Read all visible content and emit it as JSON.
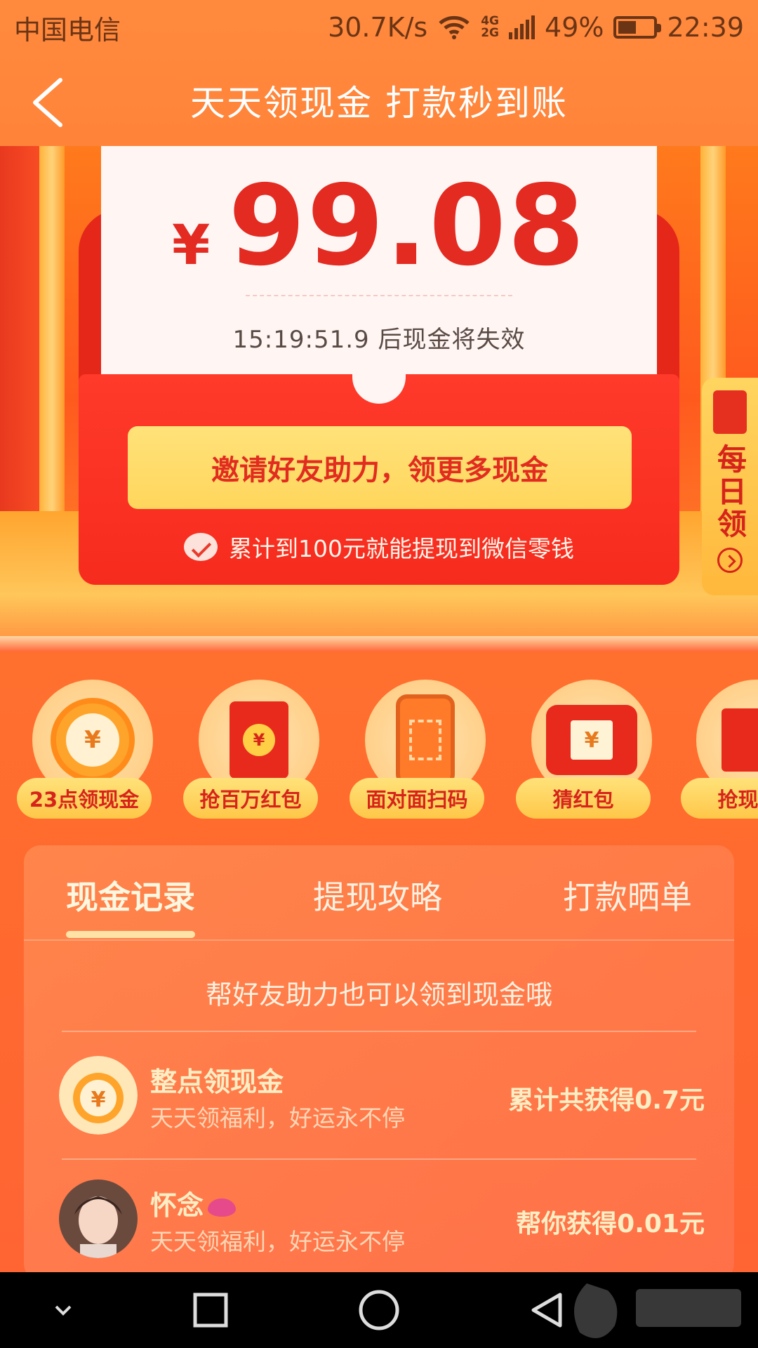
{
  "status_bar": {
    "carrier": "中国电信",
    "speed": "30.7K/s",
    "net_top": "4G",
    "net_bottom": "2G",
    "battery": "49%",
    "time": "22:39"
  },
  "header": {
    "title": "天天领现金 打款秒到账"
  },
  "hero": {
    "currency": "¥",
    "amount": "99.08",
    "countdown": "15:19:51.9 后现金将失效",
    "invite_label": "邀请好友助力，领更多现金",
    "tip": "累计到100元就能提现到微信零钱",
    "daily_label": "每日领"
  },
  "shortcuts": [
    {
      "label": "23点领现金",
      "icon": "alarm-clock-icon"
    },
    {
      "label": "抢百万红包",
      "icon": "red-envelope-icon"
    },
    {
      "label": "面对面扫码",
      "icon": "phone-scan-icon"
    },
    {
      "label": "猜红包",
      "icon": "red-bag-icon"
    },
    {
      "label": "抢现金",
      "icon": "gift-box-icon"
    }
  ],
  "records": {
    "tabs": [
      "现金记录",
      "提现攻略",
      "打款晒单"
    ],
    "active_tab": "现金记录",
    "hint": "帮好友助力也可以领到现金哦",
    "items": [
      {
        "title": "整点领现金",
        "subtitle": "天天领福利，好运永不停",
        "amount": "累计共获得0.7元"
      },
      {
        "title": "怀念",
        "subtitle": "天天领福利，好运永不停",
        "amount": "帮你获得0.01元"
      }
    ]
  },
  "colors": {
    "accent_red": "#e32b22",
    "button_yellow": "#ffd65c",
    "background_orange": "#ff7a2e"
  }
}
